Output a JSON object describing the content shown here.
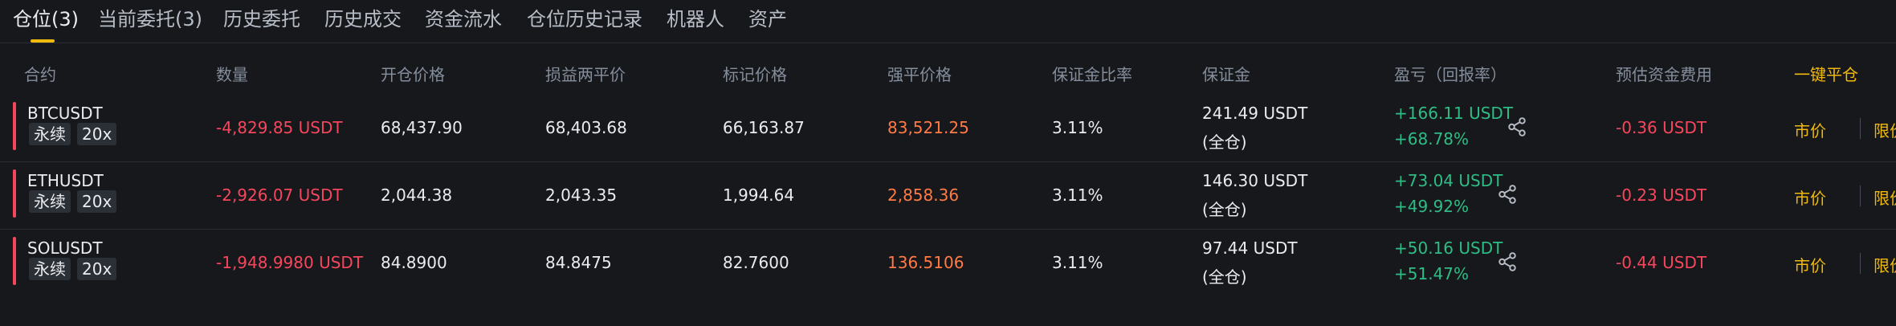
{
  "tabs": [
    {
      "label": "仓位(3)",
      "active": true
    },
    {
      "label": "当前委托(3)"
    },
    {
      "label": "历史委托"
    },
    {
      "label": "历史成交"
    },
    {
      "label": "资金流水"
    },
    {
      "label": "仓位历史记录"
    },
    {
      "label": "机器人"
    },
    {
      "label": "资产"
    }
  ],
  "columns": {
    "contract": "合约",
    "quantity": "数量",
    "entry_price": "开仓价格",
    "breakeven_price": "损益两平价",
    "mark_price": "标记价格",
    "liq_price": "强平价格",
    "margin_ratio": "保证金比率",
    "margin": "保证金",
    "pnl": "盈亏（回报率）",
    "est_funding": "预估资金费用",
    "close_all": "一键平仓"
  },
  "positions": [
    {
      "symbol": "BTCUSDT",
      "type": "永续",
      "leverage": "20x",
      "quantity": "-4,829.85 USDT",
      "entry_price": "68,437.90",
      "breakeven_price": "68,403.68",
      "mark_price": "66,163.87",
      "liq_price": "83,521.25",
      "margin_ratio": "3.11%",
      "margin": "241.49 USDT",
      "margin_mode": "(全仓)",
      "pnl": "+166.11 USDT",
      "roe": "+68.78%",
      "est_funding": "-0.36 USDT",
      "market_btn": "市价",
      "limit_btn": "限价"
    },
    {
      "symbol": "ETHUSDT",
      "type": "永续",
      "leverage": "20x",
      "quantity": "-2,926.07 USDT",
      "entry_price": "2,044.38",
      "breakeven_price": "2,043.35",
      "mark_price": "1,994.64",
      "liq_price": "2,858.36",
      "margin_ratio": "3.11%",
      "margin": "146.30 USDT",
      "margin_mode": "(全仓)",
      "pnl": "+73.04 USDT",
      "roe": "+49.92%",
      "est_funding": "-0.23 USDT",
      "market_btn": "市价",
      "limit_btn": "限价"
    },
    {
      "symbol": "SOLUSDT",
      "type": "永续",
      "leverage": "20x",
      "quantity": "-1,948.9980 USDT",
      "entry_price": "84.8900",
      "breakeven_price": "84.8475",
      "mark_price": "82.7600",
      "liq_price": "136.5106",
      "margin_ratio": "3.11%",
      "margin": "97.44 USDT",
      "margin_mode": "(全仓)",
      "pnl": "+50.16 USDT",
      "roe": "+51.47%",
      "est_funding": "-0.44 USDT",
      "market_btn": "市价",
      "limit_btn": "限价"
    }
  ],
  "icons": {
    "share": "share-icon"
  },
  "colors": {
    "accent": "#f0b90b",
    "negative": "#f6465d",
    "positive": "#2ebd85",
    "liquidation": "#ff7a45"
  }
}
